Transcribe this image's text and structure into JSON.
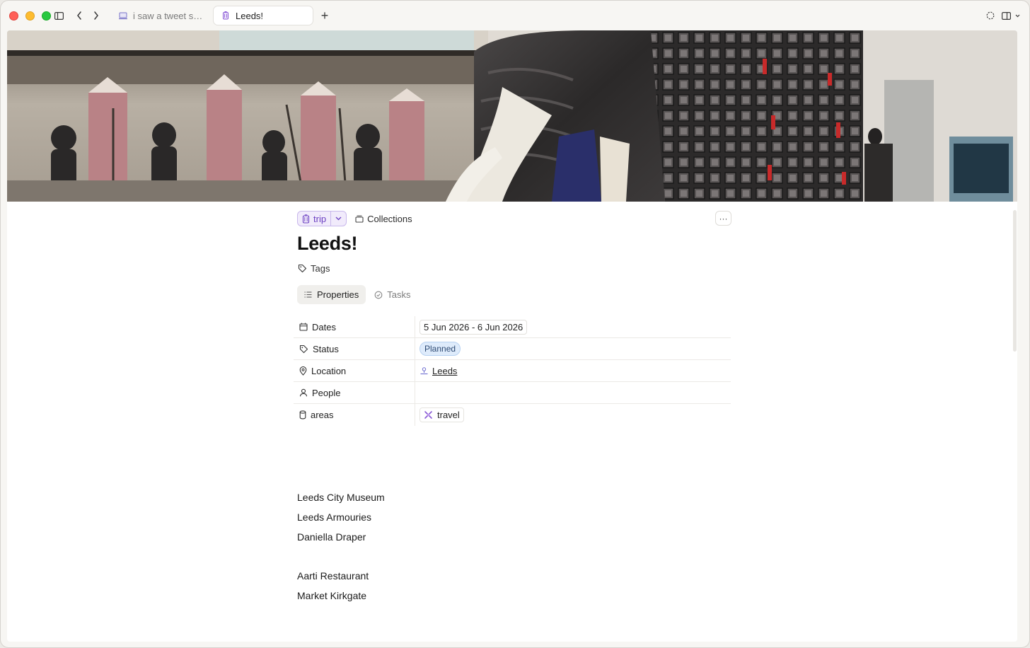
{
  "window": {
    "tabs": [
      {
        "label": "i saw a tweet so i...",
        "active": false
      },
      {
        "label": "Leeds!",
        "active": true
      }
    ],
    "new_tab_label": "+"
  },
  "page": {
    "type_label": "trip",
    "collections_label": "Collections",
    "more_label": "···",
    "title": "Leeds!",
    "tags_label": "Tags",
    "tabs": [
      {
        "label": "Properties",
        "active": true
      },
      {
        "label": "Tasks",
        "active": false
      }
    ],
    "properties": {
      "dates": {
        "key": "Dates",
        "value": "5 Jun 2026 - 6 Jun 2026"
      },
      "status": {
        "key": "Status",
        "value": "Planned"
      },
      "location": {
        "key": "Location",
        "value": "Leeds"
      },
      "people": {
        "key": "People",
        "value": ""
      },
      "areas": {
        "key": "areas",
        "value": "travel"
      }
    },
    "notes": [
      "Leeds City Museum",
      "Leeds Armouries",
      "Daniella Draper",
      "",
      "Aarti Restaurant",
      "Market Kirkgate"
    ]
  },
  "colors": {
    "accent_purple": "#6b3fc2",
    "status_blue": "#deebfb",
    "close": "#ff5f57",
    "minimize": "#febc2e",
    "zoom": "#28c840"
  }
}
